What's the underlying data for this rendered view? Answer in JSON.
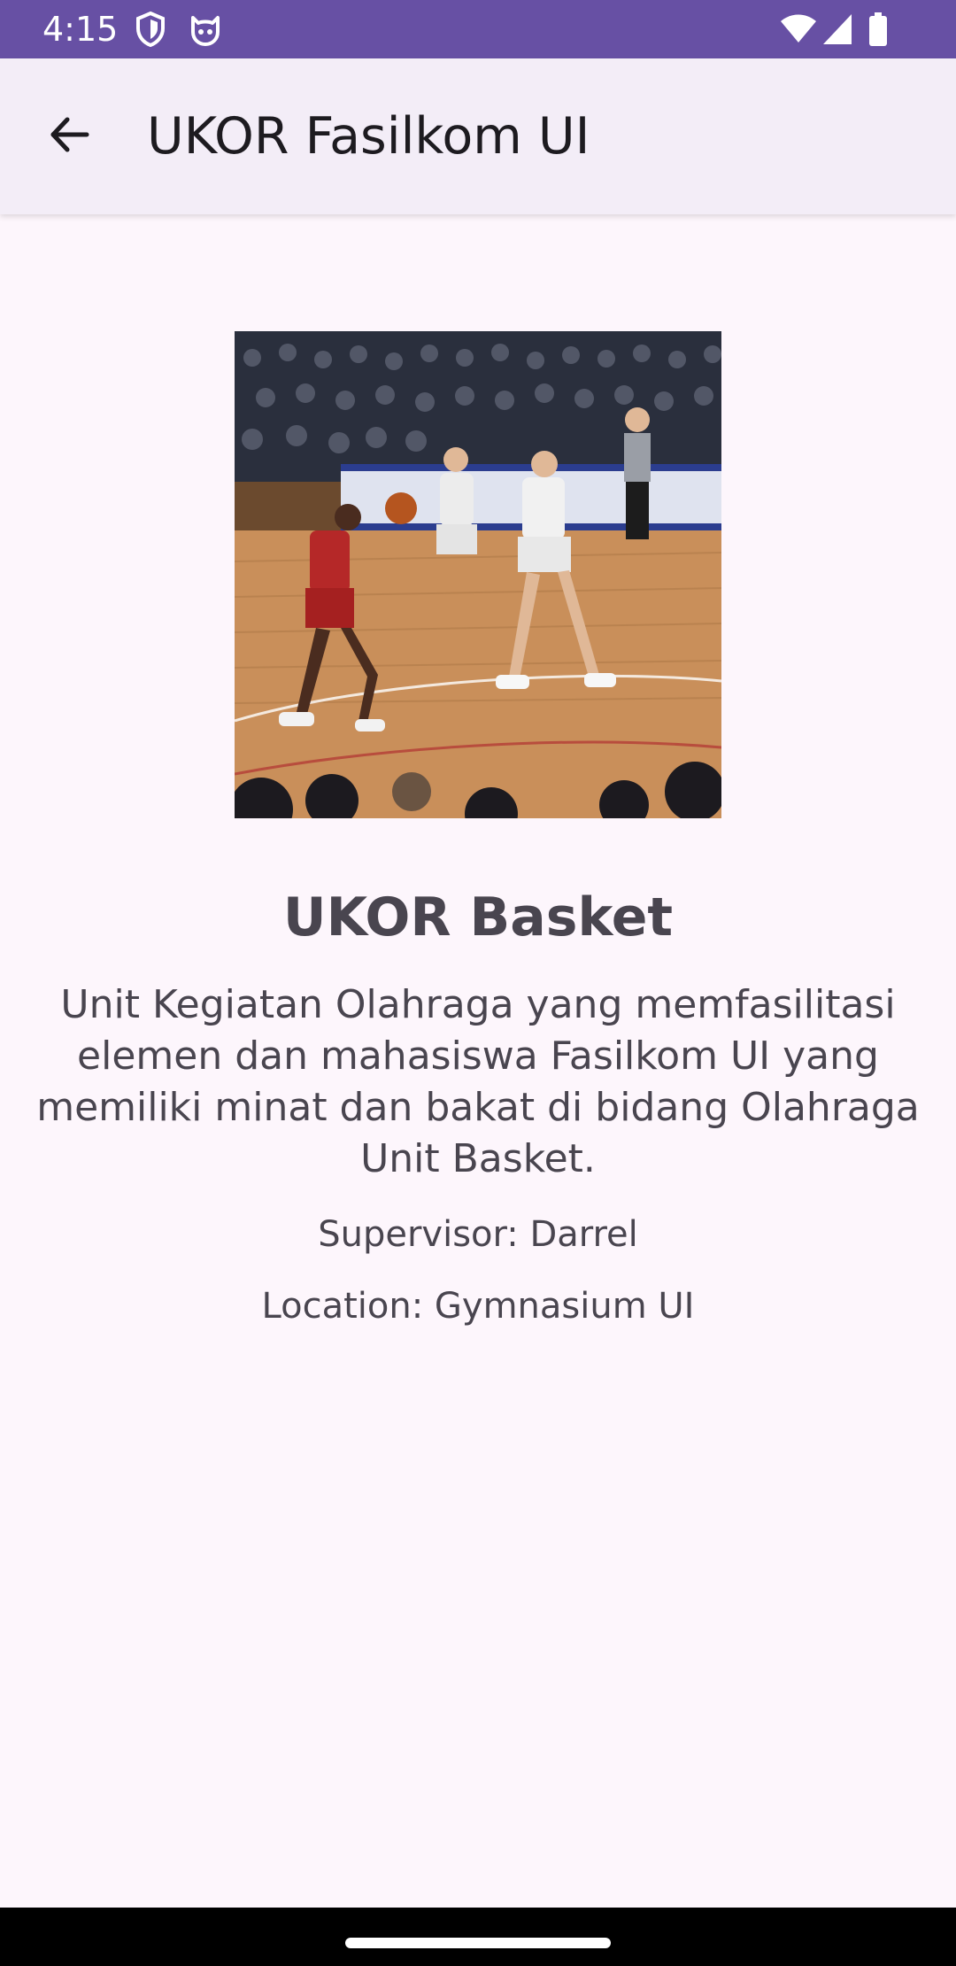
{
  "status_bar": {
    "time": "4:15",
    "background": "#6750a4",
    "left_icons": [
      "shield-icon",
      "cat-icon"
    ],
    "right_icons": [
      "wifi-icon",
      "signal-icon",
      "battery-icon"
    ]
  },
  "app_bar": {
    "back_icon": "arrow-back-icon",
    "title": "UKOR Fasilkom UI",
    "background": "#f3edf7"
  },
  "detail": {
    "image_subject": "basketball game photo",
    "name": "UKOR Basket",
    "description": "Unit Kegiatan Olahraga yang memfasilitasi elemen dan mahasiswa Fasilkom UI yang memiliki minat dan bakat di bidang Olahraga Unit Basket.",
    "supervisor": "Supervisor: Darrel",
    "location": "Location: Gymnasium UI",
    "text_color": "#49454f",
    "page_background": "#fdf6fc"
  },
  "nav_bar": {
    "background": "#000000",
    "handle": "home-gesture-handle"
  }
}
